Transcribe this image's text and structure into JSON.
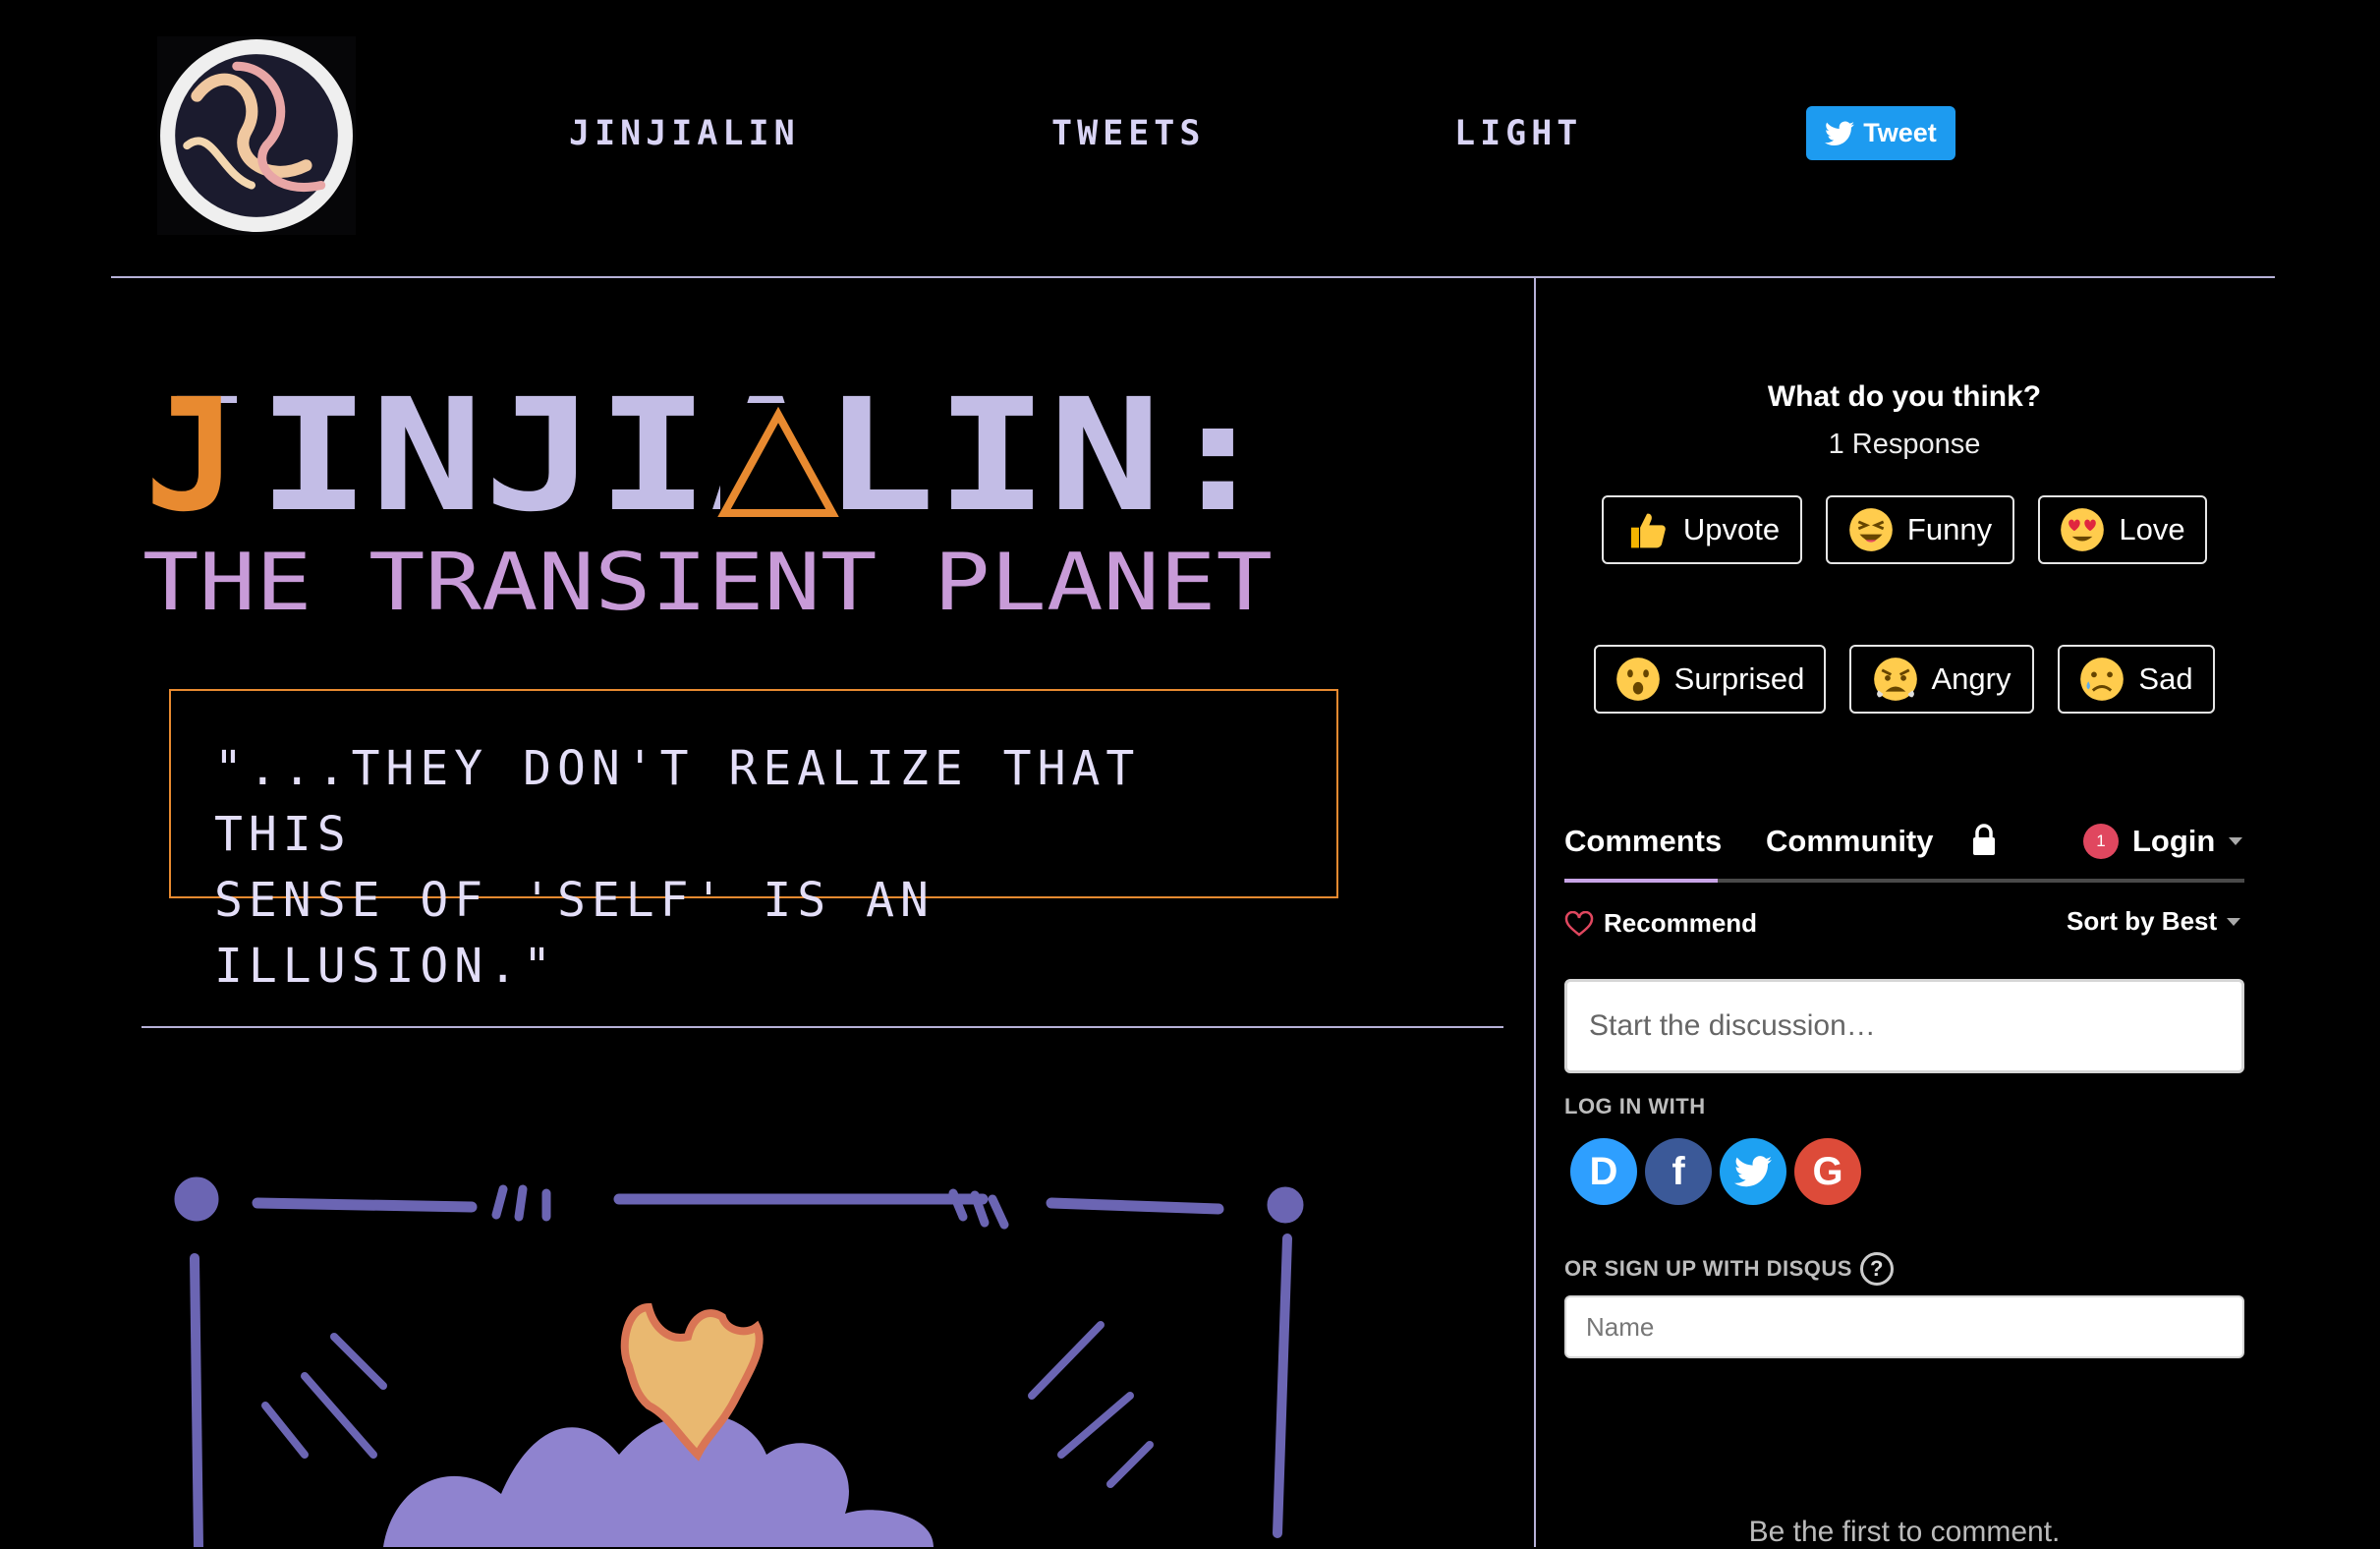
{
  "colors": {
    "accent_orange": "#e88a30",
    "lavender": "#c3bde6",
    "title_pink": "#c89bd8",
    "tweet_blue": "#1d9bf0"
  },
  "nav": {
    "logo_icon": "planet-swirl-logo",
    "links": [
      "JINJIALIN",
      "TWEETS",
      "LIGHT"
    ],
    "tweet_button": {
      "label": "Tweet",
      "icon": "twitter-bird-icon"
    }
  },
  "hero": {
    "title": "JINJIALIN:",
    "subtitle": "THE TRANSIENT PLANET",
    "quote_line1": "\"...THEY DON'T REALIZE THAT THIS",
    "quote_line2": "SENSE OF 'SELF' IS AN ILLUSION.\""
  },
  "comments": {
    "question": "What do you think?",
    "response_count": "1 Response",
    "reactions": [
      {
        "label": "Upvote",
        "icon": "thumbs-up-icon"
      },
      {
        "label": "Funny",
        "icon": "laughing-face-icon"
      },
      {
        "label": "Love",
        "icon": "heart-eyes-icon"
      },
      {
        "label": "Surprised",
        "icon": "surprised-face-icon"
      },
      {
        "label": "Angry",
        "icon": "angry-face-icon"
      },
      {
        "label": "Sad",
        "icon": "sad-face-icon"
      }
    ],
    "tabs": {
      "comments": "Comments",
      "community": "Community"
    },
    "login": {
      "badge": "1",
      "label": "Login"
    },
    "recommend": "Recommend",
    "sort": "Sort by Best",
    "input_placeholder": "Start the discussion…",
    "login_with": "LOG IN WITH",
    "social": [
      {
        "name": "Disqus",
        "glyph": "D",
        "color": "#2e9fff"
      },
      {
        "name": "Facebook",
        "glyph": "f",
        "color": "#3b5998"
      },
      {
        "name": "Twitter",
        "glyph": "",
        "color": "#1da1f2"
      },
      {
        "name": "Google",
        "glyph": "G",
        "color": "#dd4b39"
      }
    ],
    "signup_label": "OR SIGN UP WITH DISQUS",
    "help_glyph": "?",
    "name_placeholder": "Name",
    "empty_state": "Be the first to comment."
  }
}
